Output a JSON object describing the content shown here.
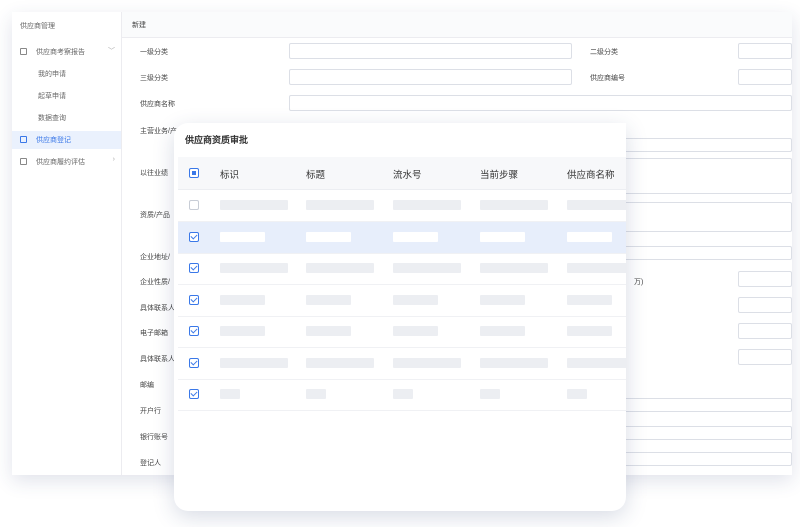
{
  "sidebar": {
    "title": "供应商管理",
    "items": [
      {
        "label": "供应商考察报告",
        "icon": "calendar-icon",
        "arrow": "﹀"
      },
      {
        "label": "我的申请"
      },
      {
        "label": "起草申请"
      },
      {
        "label": "数据查询"
      },
      {
        "label": "供应商登记",
        "icon": "register-icon"
      },
      {
        "label": "供应商履约评估",
        "icon": "evaluate-icon",
        "arrow": "›"
      }
    ]
  },
  "main": {
    "header": "新建",
    "fields": {
      "level1": "一级分类",
      "level2": "二级分类",
      "level3": "三级分类",
      "supplier_code": "供应商编号",
      "supplier_name": "供应商名称",
      "main_business": "主营业务/产",
      "past_performance": "以往业绩",
      "qualification": "资质/产品",
      "address": "企业地址/",
      "nature": "企业性质/",
      "unit_wan": "万)",
      "contact1": "具体联系人",
      "email": "电子邮箱",
      "contact2": "具体联系人",
      "postcode": "邮编",
      "bank": "开户行",
      "account": "银行账号",
      "registrant": "登记人"
    }
  },
  "modal": {
    "title": "供应商资质审批",
    "columns": [
      "标识",
      "标题",
      "流水号",
      "当前步骤",
      "供应商名称"
    ],
    "rows": [
      {
        "checked": false,
        "selected": false
      },
      {
        "checked": true,
        "selected": true
      },
      {
        "checked": true,
        "selected": false
      },
      {
        "checked": true,
        "selected": false
      },
      {
        "checked": true,
        "selected": false
      },
      {
        "checked": true,
        "selected": false
      },
      {
        "checked": true,
        "selected": false
      }
    ]
  },
  "colors": {
    "accent": "#3a78e8",
    "selected_row": "#e7eefb"
  }
}
